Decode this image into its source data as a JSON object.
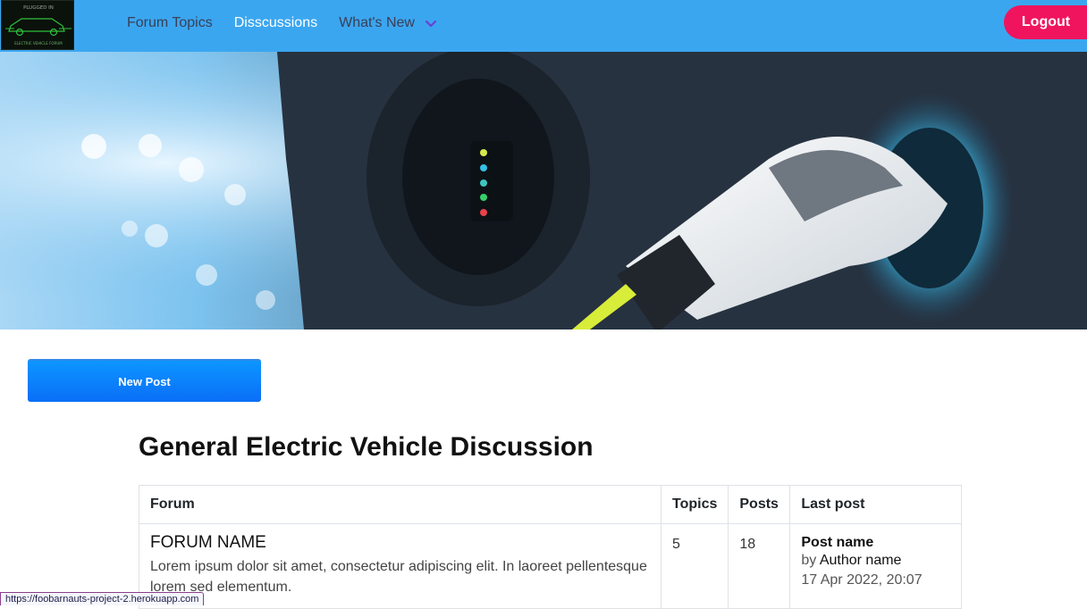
{
  "brand": {
    "logo_alt": "PLUGGED IN ELECTRIC VEHICLE FORUM",
    "logo_top": "PLUGGED IN",
    "logo_bottom": "ELECTRIC VEHICLE FORUM"
  },
  "nav": {
    "items": [
      {
        "label": "Forum Topics"
      },
      {
        "label": "Disscussions"
      },
      {
        "label": "What's New"
      }
    ],
    "dropdown_icon": "chevron-down-icon",
    "logout_label": "Logout"
  },
  "actions": {
    "new_post_label": "New Post"
  },
  "main": {
    "title": "General Electric Vehicle Discussion"
  },
  "table": {
    "headers": [
      "Forum",
      "Topics",
      "Posts",
      "Last post"
    ],
    "rows": [
      {
        "forum_name": "FORUM NAME",
        "description": "Lorem ipsum dolor sit amet, consectetur adipiscing elit. In laoreet pellentesque lorem sed elementum.",
        "topics": "5",
        "posts": "18",
        "last_post_title": "Post name",
        "last_post_by": "by",
        "last_post_author": "Author name",
        "last_post_date": "17 Apr 2022, 20:07"
      }
    ]
  },
  "status_bar": {
    "url": "https://foobarnauts-project-2.herokuapp.com"
  },
  "colors": {
    "navbar": "#3ba6f0",
    "logout": "#f0145f",
    "new_post": "#0a84ff"
  }
}
